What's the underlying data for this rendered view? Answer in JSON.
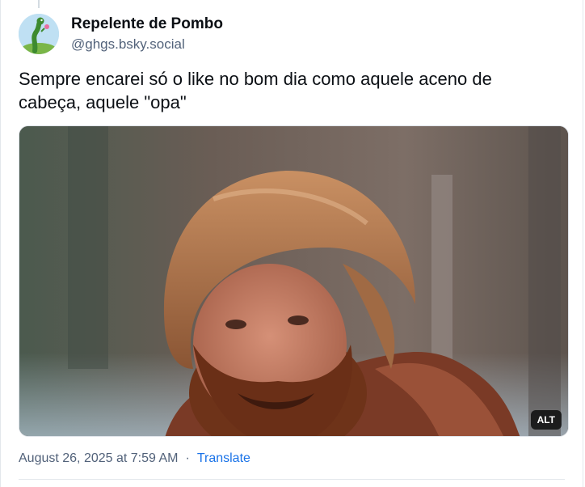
{
  "post": {
    "author": {
      "display_name": "Repelente de Pombo",
      "handle": "@ghgs.bsky.social"
    },
    "text": "Sempre encarei só o like no bom dia como aquele aceno de cabeça, aquele \"opa\"",
    "media": {
      "alt_badge": "ALT"
    },
    "timestamp": "August 26, 2025 at 7:59 AM",
    "separator": "·",
    "translate_label": "Translate"
  },
  "colors": {
    "text_primary": "#0b0f14",
    "text_secondary": "#52627a",
    "link": "#1a73e8",
    "border": "#e3e7ec"
  }
}
